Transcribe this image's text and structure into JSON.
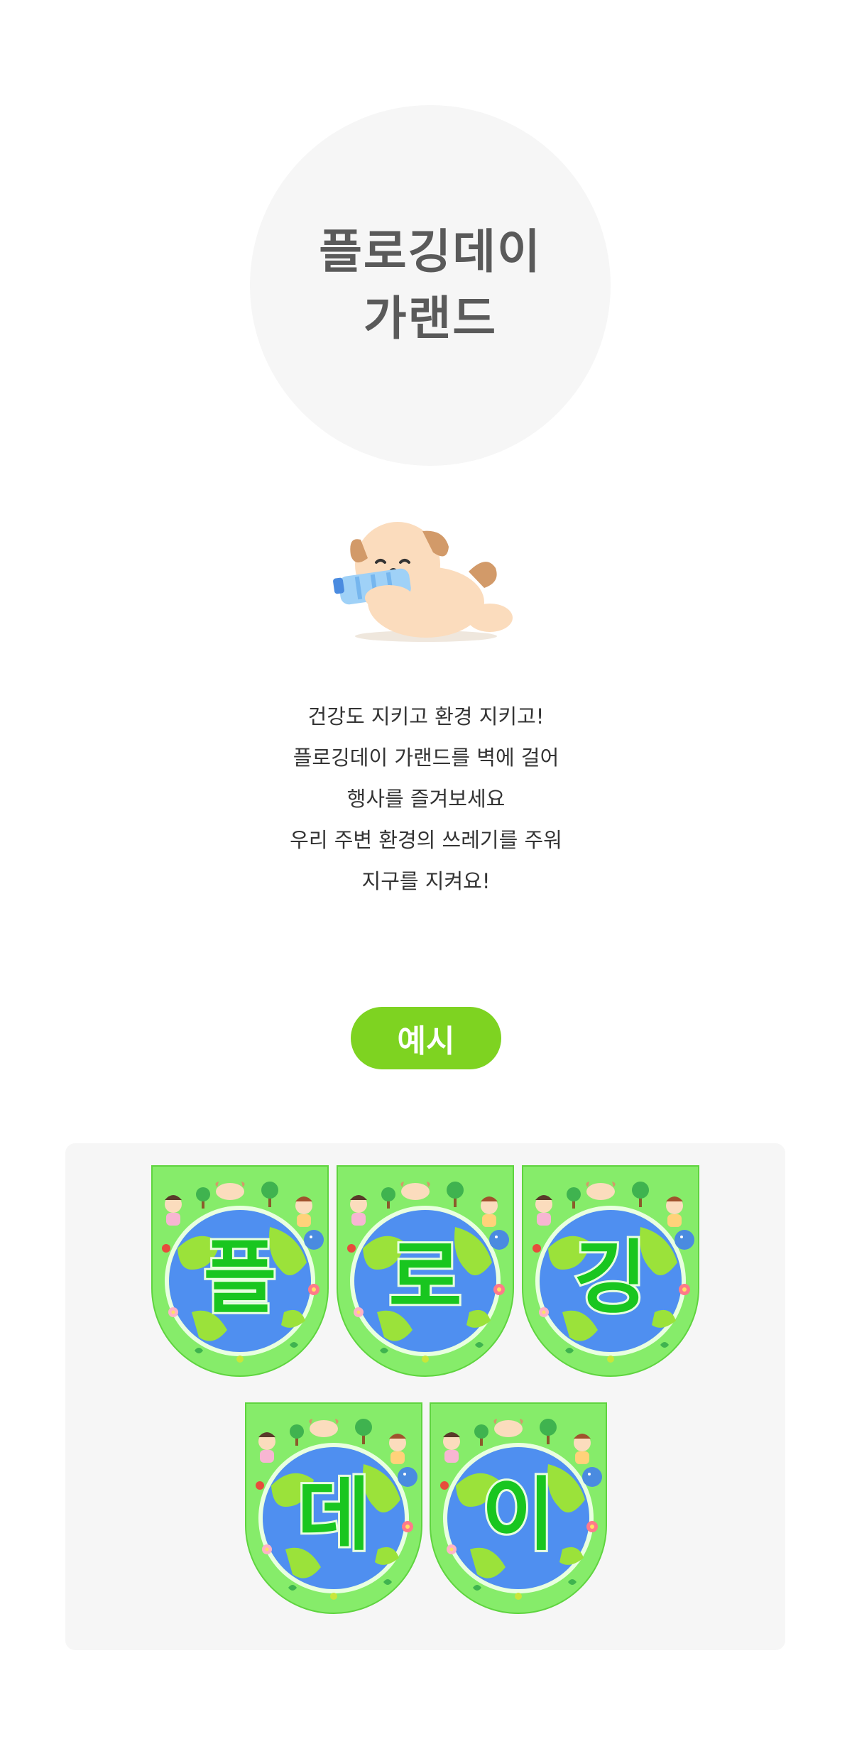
{
  "title": {
    "line1": "플로깅데이",
    "line2": "가랜드"
  },
  "description": [
    "건강도 지키고 환경 지키고!",
    "플로깅데이 가랜드를 벽에 걸어",
    "행사를 즐겨보세요",
    "우리 주변 환경의 쓰레기를 주워",
    "지구를 지켜요!"
  ],
  "example_label": "예시",
  "pennants": [
    "플",
    "로",
    "깅",
    "데",
    "이"
  ],
  "colors": {
    "accent_green": "#7ed321",
    "pennant_green": "#86ec6a",
    "letter_green": "#19c61f",
    "earth_blue": "#4f8ff0",
    "land_green": "#9be23a"
  },
  "icons": {
    "mascot": "puppy-with-bottle-icon"
  }
}
